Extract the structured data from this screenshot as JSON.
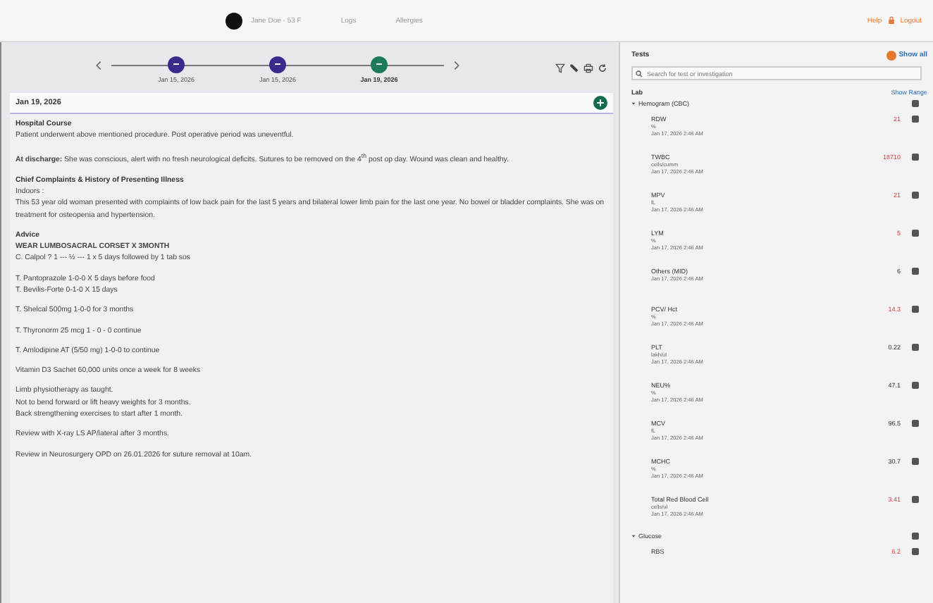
{
  "top_bar": {
    "patient": "Jane Doe · 53 F",
    "tags": [
      "Logs",
      "Allergies"
    ],
    "help": "Help",
    "logout": "Logout"
  },
  "timeline": [
    {
      "date": "Jan 15, 2026",
      "selected": false
    },
    {
      "date": "Jan 15, 2026",
      "selected": false
    },
    {
      "date": "Jan 19, 2026",
      "selected": true
    }
  ],
  "note": {
    "date": "Jan 19, 2026",
    "blocks": [
      {
        "heading": "Hospital Course",
        "lines": [
          "Patient underwent above mentioned procedure. Post operative period was uneventful."
        ]
      },
      {
        "lines": [
          "**At discharge:** She was conscious, alert with no fresh neurological deficits. Sutures to be removed on the 4$^{th}$ post op day. Wound was clean and healthy."
        ]
      },
      {
        "heading": "Chief Complaints & History of Presenting Illness",
        "lines": [
          "Indoors :",
          "This 53 year old woman presented with complaints of low back pain for the last 5 years and bilateral lower limb pain for the last one year. No bowel or bladder complaints. She was on treatment for osteopenia and hypertension."
        ]
      },
      {
        "heading": "Advice",
        "lines": [
          "**WEAR  LUMBOSACRAL  CORSET  X 3MONTH**",
          "C. Calpol ? 1 --- ½ --- 1 x 5 days followed by 1 tab sos"
        ]
      },
      {
        "lines": [
          "T. Pantoprazole 1-0-0 X 5 days before food",
          "T. Bevilis-Forte 0-1-0 X 15 days"
        ]
      },
      {
        "lines": [
          "T. Shelcal 500mg 1-0-0 for 3 months"
        ]
      },
      {
        "lines": [
          "T. Thyronorm 25 mcg 1 - 0 - 0 continue"
        ]
      },
      {
        "lines": [
          "T. Amlodipine AT (5/50 mg) 1-0-0 to continue"
        ]
      },
      {
        "lines": [
          "Vitamin D3 Sachet 60,000 units once a week for 8 weeks"
        ]
      },
      {
        "lines": [
          "Limb physiotherapy as taught.",
          "Not to bend forward or lift heavy weights for 3 months.",
          "Back strengthening exercises to start after 1 month."
        ]
      },
      {
        "lines": [
          "Review with X-ray LS AP/lateral after 3 months."
        ]
      },
      {
        "lines": [
          "Review in Neurosurgery OPD on 26.01.2026 for suture removal at 10am."
        ]
      }
    ]
  },
  "tests": {
    "title": "Tests",
    "show_all": "Show all",
    "search": {
      "placeholder": "Search for test or investigation"
    },
    "section": "Lab",
    "show_range": "Show Range",
    "groups": [
      {
        "name": "Hemogram (CBC)",
        "expanded": true,
        "tests": [
          {
            "name": "RDW",
            "unit": "%",
            "date": "Jan 17, 2026 2:46 AM",
            "value": "21",
            "abnormal": true
          },
          {
            "name": "TWBC",
            "unit": "cells/cumm",
            "date": "Jan 17, 2026 2:46 AM",
            "value": "18710",
            "abnormal": true
          },
          {
            "name": "MPV",
            "unit": "fL",
            "date": "Jan 17, 2026 2:46 AM",
            "value": "21",
            "abnormal": true
          },
          {
            "name": "LYM",
            "unit": "%",
            "date": "Jan 17, 2026 2:46 AM",
            "value": "5",
            "abnormal": true
          },
          {
            "name": "Others (MID)",
            "date": "Jan 17, 2026 2:46 AM",
            "value": "6",
            "abnormal": false
          },
          {
            "name": "PCV/ Hct",
            "unit": "%",
            "date": "Jan 17, 2026 2:46 AM",
            "value": "14.3",
            "abnormal": true
          },
          {
            "name": "PLT",
            "unit": "lakh/ul",
            "date": "Jan 17, 2026 2:46 AM",
            "value": "0.22",
            "abnormal": false
          },
          {
            "name": "NEU%",
            "unit": "%",
            "date": "Jan 17, 2026 2:46 AM",
            "value": "47.1",
            "abnormal": false
          },
          {
            "name": "MCV",
            "unit": "fL",
            "date": "Jan 17, 2026 2:46 AM",
            "value": "96.5",
            "abnormal": false
          },
          {
            "name": "MCHC",
            "unit": "%",
            "date": "Jan 17, 2026 2:46 AM",
            "value": "30.7",
            "abnormal": false
          },
          {
            "name": "Total Red Blood Cell",
            "unit": "cells/ul",
            "date": "Jan 17, 2026 2:46 AM",
            "value": "3.41",
            "abnormal": true
          }
        ]
      },
      {
        "name": "Glucose",
        "expanded": true,
        "tests": [
          {
            "name": "RBS",
            "value": "6.2",
            "abnormal": true
          }
        ]
      }
    ]
  }
}
